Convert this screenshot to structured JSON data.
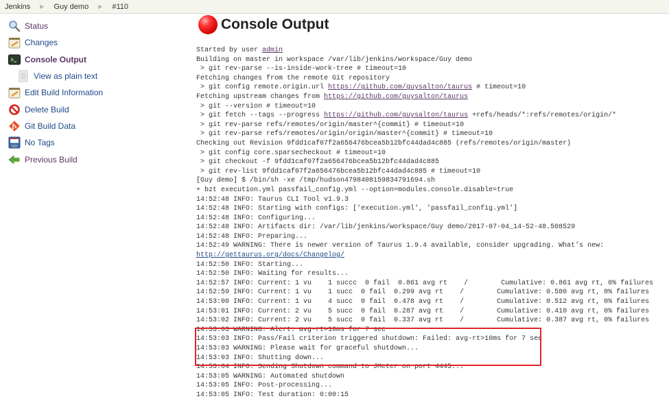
{
  "breadcrumb": [
    {
      "label": "Jenkins"
    },
    {
      "label": "Guy demo"
    },
    {
      "label": "#110"
    }
  ],
  "sidebar": {
    "items": [
      {
        "label": "Status",
        "icon": "magnifier-icon"
      },
      {
        "label": "Changes",
        "icon": "notepad-icon"
      },
      {
        "label": "Console Output",
        "icon": "terminal-icon"
      },
      {
        "label": "View as plain text",
        "icon": "document-icon"
      },
      {
        "label": "Edit Build Information",
        "icon": "notepad-icon"
      },
      {
        "label": "Delete Build",
        "icon": "no-entry-icon"
      },
      {
        "label": "Git Build Data",
        "icon": "git-icon"
      },
      {
        "label": "No Tags",
        "icon": "save-icon"
      },
      {
        "label": "Previous Build",
        "icon": "arrow-left-icon"
      }
    ]
  },
  "main": {
    "title": "Console Output",
    "status_color": "#e02424"
  },
  "console": {
    "started_prefix": "Started by user ",
    "started_user": "admin",
    "repo_url": "https://github.com/guysalton/taurus",
    "changelog_url": "http://gettaurus.org/docs/Changelog/",
    "lines": {
      "l2": "Building on master in workspace /var/lib/jenkins/workspace/Guy demo",
      "l3": " > git rev-parse --is-inside-work-tree # timeout=10",
      "l4": "Fetching changes from the remote Git repository",
      "l5a": " > git config remote.origin.url ",
      "l5b": " # timeout=10",
      "l6a": "Fetching upstream changes from ",
      "l7": " > git --version # timeout=10",
      "l8a": " > git fetch --tags --progress ",
      "l8b": " +refs/heads/*:refs/remotes/origin/*",
      "l9": " > git rev-parse refs/remotes/origin/master^{commit} # timeout=10",
      "l10": " > git rev-parse refs/remotes/origin/origin/master^{commit} # timeout=10",
      "l11": "Checking out Revision 9fdd1caf07f2a656476bcea5b12bfc44dad4c885 (refs/remotes/origin/master)",
      "l12": " > git config core.sparsecheckout # timeout=10",
      "l13": " > git checkout -f 9fdd1caf07f2a656476bcea5b12bfc44dad4c885",
      "l14": " > git rev-list 9fdd1caf07f2a656476bcea5b12bfc44dad4c885 # timeout=10",
      "l15": "[Guy demo] $ /bin/sh -xe /tmp/hudson4798408159834791694.sh",
      "l16": "+ bzt execution.yml passfail_config.yml --option=modules.console.disable=true",
      "l17": "14:52:48 INFO: Taurus CLI Tool v1.9.3",
      "l18": "14:52:48 INFO: Starting with configs: ['execution.yml', 'passfail_config.yml']",
      "l19": "14:52:48 INFO: Configuring...",
      "l20": "14:52:48 INFO: Artifacts dir: /var/lib/jenkins/workspace/Guy demo/2017-07-04_14-52-48.508529",
      "l21": "14:52:48 INFO: Preparing...",
      "l22": "14:52:49 WARNING: There is newer version of Taurus 1.9.4 available, consider upgrading. What's new:",
      "l24": "14:52:50 INFO: Starting...",
      "l25": "14:52:50 INFO: Waiting for results...",
      "l26": "14:52:57 INFO: Current: 1 vu    1 succc  0 fail  0.861 avg rt    /        Cumulative: 0.861 avg rt, 0% failures",
      "l27": "14:52:59 INFO: Current: 1 vu    1 succ  0 fail  0.299 avg rt    /        Cumulative: 0.580 avg rt, 0% failures",
      "l28": "14:53:00 INFO: Current: 1 vu    4 succ  0 fail  0.478 avg rt    /        Cumulative: 0.512 avg rt, 0% failures",
      "l29": "14:53:01 INFO: Current: 2 vu    5 succ  0 fail  0.287 avg rt    /        Cumulative: 0.410 avg rt, 0% failures",
      "l30": "14:53:02 INFO: Current: 2 vu    5 succ  0 fail  0.337 avg rt    /        Cumulative: 0.387 avg rt, 0% failures",
      "l31": "14:53:03 WARNING: Alert: avg-rt>10ms for 7 sec",
      "l32": "14:53:03 INFO: Pass/Fail criterion triggered shutdown: Failed: avg-rt>10ms for 7 sec",
      "l33": "14:53:03 WARNING: Please wait for graceful shutdown...",
      "l34": "14:53:03 INFO: Shutting down...",
      "l35": "14:53:04 INFO: Sending Shutdown command to JMeter on port 4445...",
      "l36": "14:53:05 WARNING: Automated shutdown",
      "l37": "14:53:05 INFO: Post-processing...",
      "l38": "14:53:05 INFO: Test duration: 0:00:15"
    }
  }
}
